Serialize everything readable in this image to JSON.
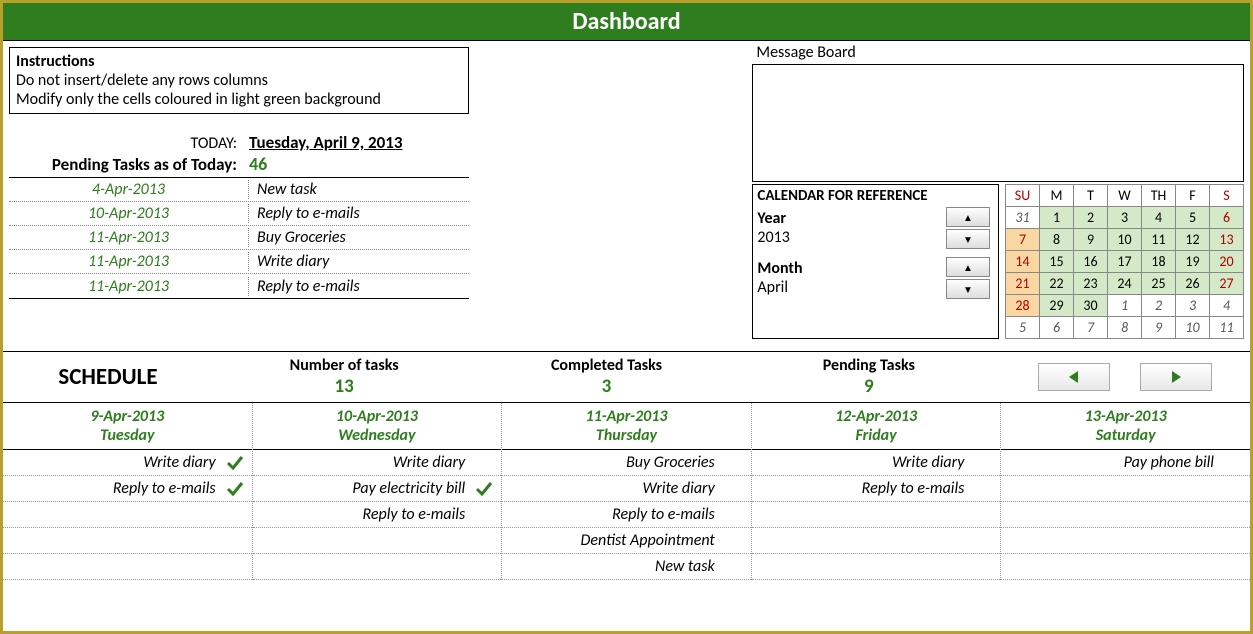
{
  "banner": "Dashboard",
  "instructions": {
    "heading": "Instructions",
    "line1": "Do not insert/delete any rows columns",
    "line2": "Modify only the cells coloured in light green background"
  },
  "today": {
    "label": "TODAY:",
    "value": "Tuesday, April 9, 2013"
  },
  "pending_summary": {
    "label": "Pending Tasks as of Today:",
    "count": "46"
  },
  "pending_list": [
    {
      "date": "4-Apr-2013",
      "task": "New task"
    },
    {
      "date": "10-Apr-2013",
      "task": "Reply to e-mails"
    },
    {
      "date": "11-Apr-2013",
      "task": "Buy Groceries"
    },
    {
      "date": "11-Apr-2013",
      "task": "Write diary"
    },
    {
      "date": "11-Apr-2013",
      "task": "Reply to e-mails"
    }
  ],
  "message_board_label": "Message Board",
  "calendar_ref": {
    "heading": "CALENDAR FOR REFERENCE",
    "year_label": "Year",
    "year_value": "2013",
    "month_label": "Month",
    "month_value": "April"
  },
  "calendar": {
    "days": [
      "SU",
      "M",
      "T",
      "W",
      "TH",
      "F",
      "S"
    ],
    "rows": [
      [
        {
          "v": "31",
          "cls": "out sun"
        },
        {
          "v": "1",
          "cls": "in"
        },
        {
          "v": "2",
          "cls": "in"
        },
        {
          "v": "3",
          "cls": "in"
        },
        {
          "v": "4",
          "cls": "in"
        },
        {
          "v": "5",
          "cls": "in"
        },
        {
          "v": "6",
          "cls": "in sat"
        }
      ],
      [
        {
          "v": "7",
          "cls": "hl sun"
        },
        {
          "v": "8",
          "cls": "in"
        },
        {
          "v": "9",
          "cls": "in"
        },
        {
          "v": "10",
          "cls": "in"
        },
        {
          "v": "11",
          "cls": "in"
        },
        {
          "v": "12",
          "cls": "in"
        },
        {
          "v": "13",
          "cls": "in sat"
        }
      ],
      [
        {
          "v": "14",
          "cls": "hl sun"
        },
        {
          "v": "15",
          "cls": "in"
        },
        {
          "v": "16",
          "cls": "in"
        },
        {
          "v": "17",
          "cls": "in"
        },
        {
          "v": "18",
          "cls": "in"
        },
        {
          "v": "19",
          "cls": "in"
        },
        {
          "v": "20",
          "cls": "in sat"
        }
      ],
      [
        {
          "v": "21",
          "cls": "hl sun"
        },
        {
          "v": "22",
          "cls": "in"
        },
        {
          "v": "23",
          "cls": "in"
        },
        {
          "v": "24",
          "cls": "in"
        },
        {
          "v": "25",
          "cls": "in"
        },
        {
          "v": "26",
          "cls": "in"
        },
        {
          "v": "27",
          "cls": "in sat"
        }
      ],
      [
        {
          "v": "28",
          "cls": "hl sun"
        },
        {
          "v": "29",
          "cls": "in"
        },
        {
          "v": "30",
          "cls": "in"
        },
        {
          "v": "1",
          "cls": "out"
        },
        {
          "v": "2",
          "cls": "out"
        },
        {
          "v": "3",
          "cls": "out"
        },
        {
          "v": "4",
          "cls": "out sat"
        }
      ],
      [
        {
          "v": "5",
          "cls": "out sun"
        },
        {
          "v": "6",
          "cls": "out"
        },
        {
          "v": "7",
          "cls": "out"
        },
        {
          "v": "8",
          "cls": "out"
        },
        {
          "v": "9",
          "cls": "out"
        },
        {
          "v": "10",
          "cls": "out"
        },
        {
          "v": "11",
          "cls": "out sat"
        }
      ]
    ]
  },
  "stats": {
    "schedule_hd": "SCHEDULE",
    "num_tasks_label": "Number of tasks",
    "num_tasks": "13",
    "completed_label": "Completed Tasks",
    "completed": "3",
    "pending_label": "Pending Tasks",
    "pending": "9"
  },
  "schedule": [
    {
      "date": "9-Apr-2013",
      "dow": "Tuesday",
      "tasks": [
        {
          "t": "Write diary",
          "done": true
        },
        {
          "t": "Reply to e-mails",
          "done": true
        },
        {
          "t": "",
          "done": false
        },
        {
          "t": "",
          "done": false
        },
        {
          "t": "",
          "done": false
        }
      ]
    },
    {
      "date": "10-Apr-2013",
      "dow": "Wednesday",
      "tasks": [
        {
          "t": "Write diary",
          "done": false
        },
        {
          "t": "Pay electricity bill",
          "done": true
        },
        {
          "t": "Reply to e-mails",
          "done": false
        },
        {
          "t": "",
          "done": false
        },
        {
          "t": "",
          "done": false
        }
      ]
    },
    {
      "date": "11-Apr-2013",
      "dow": "Thursday",
      "tasks": [
        {
          "t": "Buy Groceries",
          "done": false
        },
        {
          "t": "Write diary",
          "done": false
        },
        {
          "t": "Reply to e-mails",
          "done": false
        },
        {
          "t": "Dentist Appointment",
          "done": false
        },
        {
          "t": "New task",
          "done": false
        }
      ]
    },
    {
      "date": "12-Apr-2013",
      "dow": "Friday",
      "tasks": [
        {
          "t": "Write diary",
          "done": false
        },
        {
          "t": "Reply to e-mails",
          "done": false
        },
        {
          "t": "",
          "done": false
        },
        {
          "t": "",
          "done": false
        },
        {
          "t": "",
          "done": false
        }
      ]
    },
    {
      "date": "13-Apr-2013",
      "dow": "Saturday",
      "tasks": [
        {
          "t": "Pay phone bill",
          "done": false
        },
        {
          "t": "",
          "done": false
        },
        {
          "t": "",
          "done": false
        },
        {
          "t": "",
          "done": false
        },
        {
          "t": "",
          "done": false
        }
      ]
    }
  ]
}
